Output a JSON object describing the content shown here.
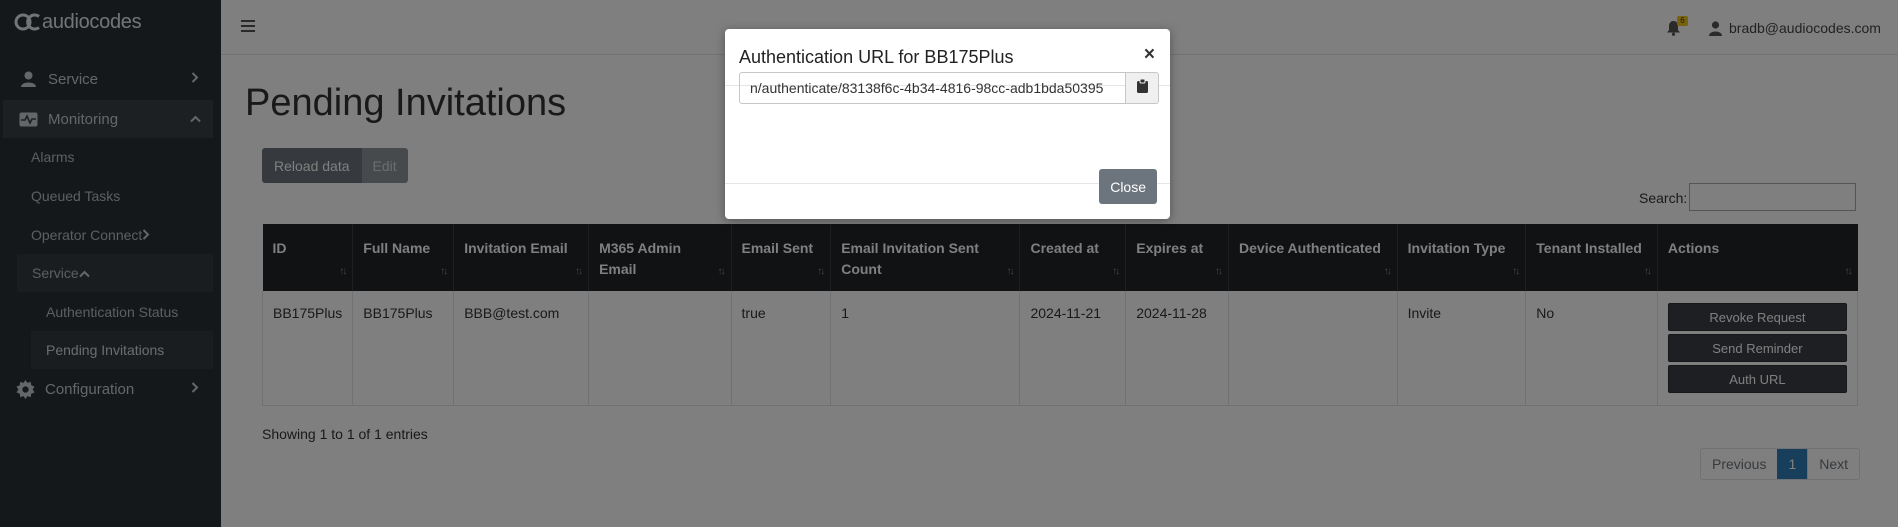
{
  "brand": {
    "name": "audiocodes"
  },
  "sidebar": {
    "items": [
      {
        "label": "Service",
        "icon": "user-icon"
      },
      {
        "label": "Monitoring",
        "icon": "monitor-icon"
      },
      {
        "label": "Alarms"
      },
      {
        "label": "Queued Tasks"
      },
      {
        "label": "Operator Connect"
      },
      {
        "label": "Service"
      },
      {
        "label": "Authentication Status"
      },
      {
        "label": "Pending Invitations"
      },
      {
        "label": "Configuration",
        "icon": "gear-icon"
      }
    ]
  },
  "topbar": {
    "notification_count": "6",
    "user_email": "bradb@audiocodes.com"
  },
  "page": {
    "title": "Pending Invitations",
    "reload_label": "Reload data",
    "edit_label": "Edit",
    "search_label": "Search:",
    "showing_text": "Showing 1 to 1 of 1 entries"
  },
  "table": {
    "headers": [
      "ID",
      "Full Name",
      "Invitation Email",
      "M365 Admin Email",
      "Email Sent",
      "Email Invitation Sent Count",
      "Created at",
      "Expires at",
      "Device Authenticated",
      "Invitation Type",
      "Tenant Installed",
      "Actions"
    ],
    "rows": [
      {
        "id": "BB175Plus",
        "full_name": "BB175Plus",
        "invitation_email": "BBB@test.com",
        "m365_admin_email": "",
        "email_sent": "true",
        "email_invitation_sent_count": "1",
        "created_at": "2024-11-21",
        "expires_at": "2024-11-28",
        "device_authenticated": "",
        "invitation_type": "Invite",
        "tenant_installed": "No"
      }
    ],
    "actions": [
      "Revoke Request",
      "Send Reminder",
      "Auth URL"
    ]
  },
  "pagination": {
    "previous": "Previous",
    "current": "1",
    "next": "Next"
  },
  "modal": {
    "title": "Authentication URL for BB175Plus",
    "url_value": "n/authenticate/83138f6c-4b34-4816-98cc-adb1bda50395",
    "close_label": "Close",
    "close_x": "×"
  },
  "colors": {
    "sidebar_bg": "#2b3035",
    "table_header_bg": "#212529",
    "accent": "#2f7fb8",
    "button_gray": "#6c757d"
  }
}
